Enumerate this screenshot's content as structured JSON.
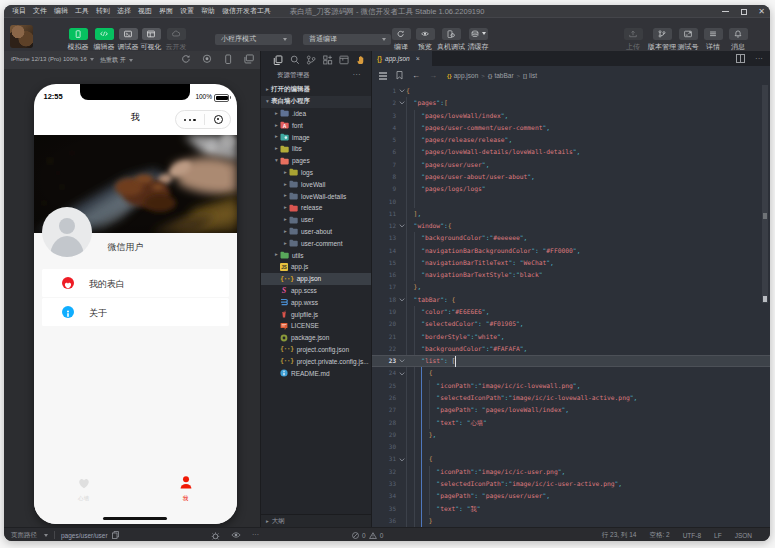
{
  "colors": {
    "accent_green": "#07c160",
    "chrome_bg": "#323338",
    "sidebar_bg": "#24262b",
    "editor_bg": "#2c3038",
    "syntax_string": "#dd7a7e",
    "syntax_punct": "#4fb3c4",
    "syntax_brace": "#d19a5f",
    "phone_selected_red": "#f01905",
    "phone_inactive_gray": "#e6e6e6",
    "info_blue": "#10aeff",
    "heart_red": "#ee1c25"
  },
  "titlebar": {
    "menus": [
      "项目",
      "文件",
      "编辑",
      "工具",
      "转到",
      "选择",
      "视图",
      "界面",
      "设置",
      "帮助",
      "微信开发者工具"
    ],
    "title": "表白墙_刀客源码网 - 微信开发者工具 Stable 1.06.2209190"
  },
  "toolbar": {
    "tools": [
      {
        "label": "模拟器",
        "icon": "phone",
        "style": "green"
      },
      {
        "label": "编辑器",
        "icon": "code",
        "style": "green"
      },
      {
        "label": "调试器",
        "icon": "debug",
        "style": "gray"
      },
      {
        "label": "可视化",
        "icon": "layout",
        "style": "gray"
      },
      {
        "label": "云开发",
        "icon": "cloud",
        "style": "dim"
      }
    ],
    "mode_select": "小程序模式",
    "compile_select": "普通编译",
    "actions": [
      {
        "label": "编译",
        "icon": "refresh"
      },
      {
        "label": "预览",
        "icon": "eye"
      },
      {
        "label": "真机调试",
        "icon": "phonebug"
      },
      {
        "label": "清缓存",
        "icon": "stack",
        "caret": true
      }
    ],
    "right_actions": [
      {
        "label": "上传",
        "icon": "upload",
        "style": "dim"
      },
      {
        "label": "版本管理",
        "icon": "branch"
      },
      {
        "label": "测试号",
        "icon": "testid"
      },
      {
        "label": "详情",
        "icon": "lines"
      },
      {
        "label": "消息",
        "icon": "bell"
      }
    ]
  },
  "simulator": {
    "device": "iPhone 12/13 (Pro) 100% 16",
    "hot_reload": "热重载 开",
    "icons": [
      "rotate",
      "record",
      "device",
      "windows"
    ]
  },
  "phone": {
    "time": "12:55",
    "battery": "100%",
    "nav_title": "我",
    "user_name": "微信用户",
    "cards": [
      {
        "icon": "heart",
        "label": "我的表白"
      },
      {
        "icon": "info",
        "label": "关于"
      }
    ],
    "tabs": [
      {
        "icon": "heart",
        "label": "心墙",
        "active": false
      },
      {
        "icon": "person",
        "label": "我",
        "active": true
      }
    ]
  },
  "sidebar": {
    "icons": [
      "files",
      "search",
      "git",
      "blocks",
      "package",
      "hand"
    ],
    "header": "资源管理器",
    "more": "...",
    "tree": [
      {
        "label": "打开的编辑器",
        "type": "section",
        "chev": "▸",
        "lvl": 0
      },
      {
        "label": "表白墙小程序",
        "type": "section",
        "chev": "▾",
        "lvl": 0,
        "hl": true
      },
      {
        "label": ".idea",
        "icon": "folder",
        "color": "#5f7295",
        "chev": "▸",
        "lvl": 1
      },
      {
        "label": "font",
        "icon": "folder-a",
        "color": "#e25d5d",
        "chev": "▸",
        "lvl": 1
      },
      {
        "label": "image",
        "icon": "folder-img",
        "color": "#3fa8a0",
        "chev": "▸",
        "lvl": 1
      },
      {
        "label": "libs",
        "icon": "folder",
        "color": "#b2ac38",
        "chev": "▸",
        "lvl": 1
      },
      {
        "label": "pages",
        "icon": "folder",
        "color": "#e8705f",
        "chev": "▾",
        "lvl": 1
      },
      {
        "label": "logs",
        "icon": "folder",
        "color": "#a8a233",
        "chev": "▸",
        "lvl": 2
      },
      {
        "label": "loveWall",
        "icon": "folder",
        "color": "#5d6b80",
        "chev": "▸",
        "lvl": 2
      },
      {
        "label": "loveWall-details",
        "icon": "folder",
        "color": "#5d6b80",
        "chev": "▸",
        "lvl": 2
      },
      {
        "label": "release",
        "icon": "folder",
        "color": "#d95550",
        "chev": "▸",
        "lvl": 2
      },
      {
        "label": "user",
        "icon": "folder",
        "color": "#5d6b80",
        "chev": "▸",
        "lvl": 2
      },
      {
        "label": "user-about",
        "icon": "folder",
        "color": "#5d6b80",
        "chev": "▸",
        "lvl": 2
      },
      {
        "label": "user-comment",
        "icon": "folder",
        "color": "#5d6b80",
        "chev": "▸",
        "lvl": 2
      },
      {
        "label": "utils",
        "icon": "folder",
        "color": "#58a85a",
        "chev": "▸",
        "lvl": 1
      },
      {
        "label": "app.js",
        "icon": "js",
        "lvl": 1
      },
      {
        "label": "app.json",
        "icon": "braces",
        "color": "#d6a523",
        "lvl": 1,
        "selected": true
      },
      {
        "label": "app.scss",
        "icon": "scss",
        "lvl": 1
      },
      {
        "label": "app.wxss",
        "icon": "wxss",
        "lvl": 1
      },
      {
        "label": "gulpfile.js",
        "icon": "gulp",
        "lvl": 1
      },
      {
        "label": "LICENSE",
        "icon": "license",
        "lvl": 1
      },
      {
        "label": "package.json",
        "icon": "pkg",
        "lvl": 1
      },
      {
        "label": "project.config.json",
        "icon": "braces",
        "color": "#b99c3c",
        "lvl": 1
      },
      {
        "label": "project.private.config.js...",
        "icon": "braces",
        "color": "#b99c3c",
        "lvl": 1
      },
      {
        "label": "README.md",
        "icon": "md",
        "lvl": 1
      }
    ],
    "outline": "大纲"
  },
  "editor": {
    "tab": {
      "icon": "{}",
      "name": "app.json",
      "close": "×"
    },
    "breadcrumb": [
      {
        "icon": "{}",
        "label": "app.json",
        "gold": true
      },
      {
        "icon": "{}",
        "label": "tabBar"
      },
      {
        "icon": "[]",
        "label": "list"
      }
    ],
    "code": [
      {
        "n": 1,
        "fold": true,
        "t": [
          [
            "b",
            "{"
          ]
        ]
      },
      {
        "n": 2,
        "fold": true,
        "t": [
          [
            "w",
            "  "
          ],
          [
            "p",
            "\""
          ],
          [
            "s",
            "pages"
          ],
          [
            "p",
            "\":"
          ],
          [
            "b",
            "["
          ]
        ]
      },
      {
        "n": 3,
        "t": [
          [
            "w",
            "    "
          ],
          [
            "p",
            "\""
          ],
          [
            "s",
            "pages/loveWall/index"
          ],
          [
            "p",
            "\","
          ]
        ]
      },
      {
        "n": 4,
        "t": [
          [
            "w",
            "    "
          ],
          [
            "p",
            "\""
          ],
          [
            "s",
            "pages/user-comment/user-comment"
          ],
          [
            "p",
            "\","
          ]
        ]
      },
      {
        "n": 5,
        "t": [
          [
            "w",
            "    "
          ],
          [
            "p",
            "\""
          ],
          [
            "s",
            "pages/release/release"
          ],
          [
            "p",
            "\","
          ]
        ]
      },
      {
        "n": 6,
        "t": [
          [
            "w",
            "    "
          ],
          [
            "p",
            "\""
          ],
          [
            "s",
            "pages/loveWall-details/loveWall-details"
          ],
          [
            "p",
            "\","
          ]
        ]
      },
      {
        "n": 7,
        "t": [
          [
            "w",
            "    "
          ],
          [
            "p",
            "\""
          ],
          [
            "s",
            "pages/user/user"
          ],
          [
            "p",
            "\","
          ]
        ]
      },
      {
        "n": 8,
        "t": [
          [
            "w",
            "    "
          ],
          [
            "p",
            "\""
          ],
          [
            "s",
            "pages/user-about/user-about"
          ],
          [
            "p",
            "\","
          ]
        ]
      },
      {
        "n": 9,
        "t": [
          [
            "w",
            "    "
          ],
          [
            "p",
            "\""
          ],
          [
            "s",
            "pages/logs/logs"
          ],
          [
            "p",
            "\""
          ]
        ]
      },
      {
        "n": 10,
        "t": []
      },
      {
        "n": 11,
        "t": [
          [
            "w",
            "  "
          ],
          [
            "b",
            "]"
          ],
          [
            "p",
            ","
          ]
        ]
      },
      {
        "n": 12,
        "fold": true,
        "t": [
          [
            "w",
            "  "
          ],
          [
            "p",
            "\""
          ],
          [
            "s",
            "window"
          ],
          [
            "p",
            "\":"
          ],
          [
            "b",
            "{"
          ]
        ]
      },
      {
        "n": 13,
        "t": [
          [
            "w",
            "    "
          ],
          [
            "p",
            "\""
          ],
          [
            "s",
            "backgroundColor"
          ],
          [
            "p",
            "\":\""
          ],
          [
            "s",
            "#eeeeee"
          ],
          [
            "p",
            "\","
          ]
        ]
      },
      {
        "n": 14,
        "t": [
          [
            "w",
            "    "
          ],
          [
            "p",
            "\""
          ],
          [
            "s",
            "navigationBarBackgroundColor"
          ],
          [
            "p",
            "\": \""
          ],
          [
            "s",
            "#FF0000"
          ],
          [
            "p",
            "\","
          ]
        ]
      },
      {
        "n": 15,
        "t": [
          [
            "w",
            "    "
          ],
          [
            "p",
            "\""
          ],
          [
            "s",
            "navigationBarTitleText"
          ],
          [
            "p",
            "\": \""
          ],
          [
            "s",
            "WeChat"
          ],
          [
            "p",
            "\","
          ]
        ]
      },
      {
        "n": 16,
        "t": [
          [
            "w",
            "    "
          ],
          [
            "p",
            "\""
          ],
          [
            "s",
            "navigationBarTextStyle"
          ],
          [
            "p",
            "\":\""
          ],
          [
            "s",
            "black"
          ],
          [
            "p",
            "\""
          ]
        ]
      },
      {
        "n": 17,
        "t": [
          [
            "w",
            "  "
          ],
          [
            "b",
            "}"
          ],
          [
            "p",
            ","
          ]
        ]
      },
      {
        "n": 18,
        "fold": true,
        "t": [
          [
            "w",
            "  "
          ],
          [
            "p",
            "\""
          ],
          [
            "s",
            "tabBar"
          ],
          [
            "p",
            "\": "
          ],
          [
            "b",
            "{"
          ]
        ]
      },
      {
        "n": 19,
        "t": [
          [
            "w",
            "    "
          ],
          [
            "p",
            "\""
          ],
          [
            "s",
            "color"
          ],
          [
            "p",
            "\":\""
          ],
          [
            "s",
            "#E6E6E6"
          ],
          [
            "p",
            "\","
          ]
        ]
      },
      {
        "n": 20,
        "t": [
          [
            "w",
            "    "
          ],
          [
            "p",
            "\""
          ],
          [
            "s",
            "selectedColor"
          ],
          [
            "p",
            "\": \""
          ],
          [
            "s",
            "#F01905"
          ],
          [
            "p",
            "\","
          ]
        ]
      },
      {
        "n": 21,
        "t": [
          [
            "w",
            "    "
          ],
          [
            "p",
            "\""
          ],
          [
            "s",
            "borderStyle"
          ],
          [
            "p",
            "\":\""
          ],
          [
            "s",
            "white"
          ],
          [
            "p",
            "\","
          ]
        ]
      },
      {
        "n": 22,
        "t": [
          [
            "w",
            "    "
          ],
          [
            "p",
            "\""
          ],
          [
            "s",
            "backgroundColor"
          ],
          [
            "p",
            "\":\""
          ],
          [
            "s",
            "#FAFAFA"
          ],
          [
            "p",
            "\","
          ]
        ]
      },
      {
        "n": 23,
        "fold": true,
        "cur": true,
        "t": [
          [
            "w",
            "    "
          ],
          [
            "p",
            "\""
          ],
          [
            "s",
            "list"
          ],
          [
            "p",
            "\": "
          ],
          [
            "w",
            "["
          ]
        ]
      },
      {
        "n": 24,
        "fold": true,
        "t": [
          [
            "w",
            "      "
          ],
          [
            "b",
            "{"
          ]
        ]
      },
      {
        "n": 25,
        "t": [
          [
            "w",
            "        "
          ],
          [
            "p",
            "\""
          ],
          [
            "s",
            "iconPath"
          ],
          [
            "p",
            "\":\""
          ],
          [
            "s",
            "image/ic/ic-lovewall.png"
          ],
          [
            "p",
            "\","
          ]
        ]
      },
      {
        "n": 26,
        "t": [
          [
            "w",
            "        "
          ],
          [
            "p",
            "\""
          ],
          [
            "s",
            "selectedIconPath"
          ],
          [
            "p",
            "\":\""
          ],
          [
            "s",
            "image/ic/ic-lovewall-active.png"
          ],
          [
            "p",
            "\","
          ]
        ]
      },
      {
        "n": 27,
        "t": [
          [
            "w",
            "        "
          ],
          [
            "p",
            "\""
          ],
          [
            "s",
            "pagePath"
          ],
          [
            "p",
            "\": \""
          ],
          [
            "s",
            "pages/loveWall/index"
          ],
          [
            "p",
            "\","
          ]
        ]
      },
      {
        "n": 28,
        "t": [
          [
            "w",
            "        "
          ],
          [
            "p",
            "\""
          ],
          [
            "s",
            "text"
          ],
          [
            "p",
            "\": \""
          ],
          [
            "s",
            "心墙"
          ],
          [
            "p",
            "\""
          ]
        ]
      },
      {
        "n": 29,
        "t": [
          [
            "w",
            "      "
          ],
          [
            "b",
            "}"
          ],
          [
            "p",
            ","
          ]
        ]
      },
      {
        "n": 30,
        "t": []
      },
      {
        "n": 31,
        "fold": true,
        "t": [
          [
            "w",
            "      "
          ],
          [
            "b",
            "{"
          ]
        ]
      },
      {
        "n": 32,
        "t": [
          [
            "w",
            "        "
          ],
          [
            "p",
            "\""
          ],
          [
            "s",
            "iconPath"
          ],
          [
            "p",
            "\":\""
          ],
          [
            "s",
            "image/ic/ic-user.png"
          ],
          [
            "p",
            "\","
          ]
        ]
      },
      {
        "n": 33,
        "t": [
          [
            "w",
            "        "
          ],
          [
            "p",
            "\""
          ],
          [
            "s",
            "selectedIconPath"
          ],
          [
            "p",
            "\":\""
          ],
          [
            "s",
            "image/ic/ic-user-active.png"
          ],
          [
            "p",
            "\","
          ]
        ]
      },
      {
        "n": 34,
        "t": [
          [
            "w",
            "        "
          ],
          [
            "p",
            "\""
          ],
          [
            "s",
            "pagePath"
          ],
          [
            "p",
            "\": \""
          ],
          [
            "s",
            "pages/user/user"
          ],
          [
            "p",
            "\","
          ]
        ]
      },
      {
        "n": 35,
        "t": [
          [
            "w",
            "        "
          ],
          [
            "p",
            "\""
          ],
          [
            "s",
            "text"
          ],
          [
            "p",
            "\": \""
          ],
          [
            "s",
            "我"
          ],
          [
            "p",
            "\""
          ]
        ]
      },
      {
        "n": 36,
        "t": [
          [
            "w",
            "      "
          ],
          [
            "b",
            "}"
          ]
        ]
      }
    ],
    "cursor": {
      "line": 23,
      "col": 14
    }
  },
  "statusbar": {
    "left_label": "页面路径",
    "path": "pages/user/user",
    "errors": "0",
    "warnings": "0",
    "right": [
      "行 23,  列 14",
      "空格: 2",
      "UTF-8",
      "LF",
      "JSON"
    ]
  }
}
